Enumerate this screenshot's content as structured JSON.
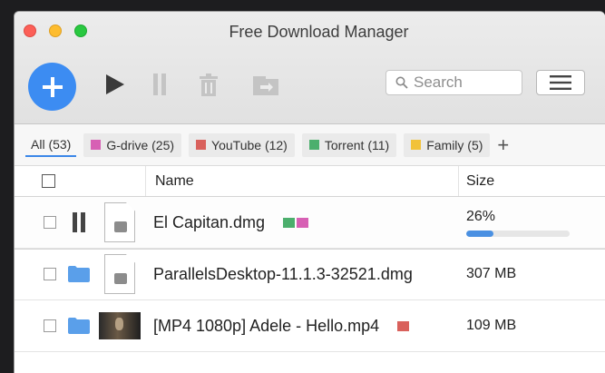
{
  "window": {
    "title": "Free Download Manager"
  },
  "toolbar": {
    "add": "add-download",
    "search_placeholder": "Search"
  },
  "tags": [
    {
      "label": "All (53)",
      "color": "",
      "active": true
    },
    {
      "label": "G-drive (25)",
      "color": "#d760b4"
    },
    {
      "label": "YouTube (12)",
      "color": "#d9615c"
    },
    {
      "label": "Torrent (11)",
      "color": "#4caf6d"
    },
    {
      "label": "Family (5)",
      "color": "#f2c23a"
    }
  ],
  "tag_plus": "+",
  "table": {
    "headers": {
      "name": "Name",
      "size": "Size"
    },
    "rows": [
      {
        "name": "El Capitan.dmg",
        "size": "26%",
        "progress": 0.26,
        "status": "paused",
        "thumb": "dmg",
        "tags": [
          "#4caf6d",
          "#d760b4"
        ]
      },
      {
        "name": "ParallelsDesktop-11.1.3-32521.dmg",
        "size": "307 MB",
        "status": "completed",
        "thumb": "dmg",
        "tags": []
      },
      {
        "name": "[MP4 1080p] Adele - Hello.mp4",
        "size": "109 MB",
        "status": "completed",
        "thumb": "video",
        "tags": [
          "#d9615c"
        ]
      }
    ]
  },
  "colors": {
    "accent": "#3c8cf2",
    "progress": "#4a90e2"
  }
}
